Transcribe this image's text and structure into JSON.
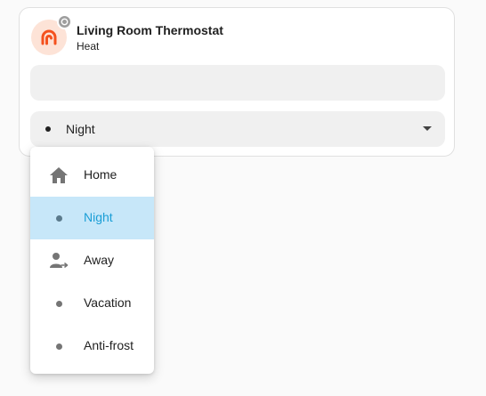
{
  "card": {
    "title": "Living Room Thermostat",
    "subtitle": "Heat",
    "icon": "thermostat-icon",
    "badge_icon": "preset-badge-icon",
    "accent_color": "#f4511e"
  },
  "preset_select": {
    "value": "Night"
  },
  "menu": {
    "items": [
      {
        "label": "Home",
        "icon": "home-icon"
      },
      {
        "label": "Night",
        "icon": "dot-icon",
        "selected": true
      },
      {
        "label": "Away",
        "icon": "person-away-icon"
      },
      {
        "label": "Vacation",
        "icon": "dot-icon"
      },
      {
        "label": "Anti-frost",
        "icon": "dot-icon"
      }
    ]
  },
  "colors": {
    "selected_background": "#c7e7f9",
    "selected_text": "#1a9ed6"
  }
}
